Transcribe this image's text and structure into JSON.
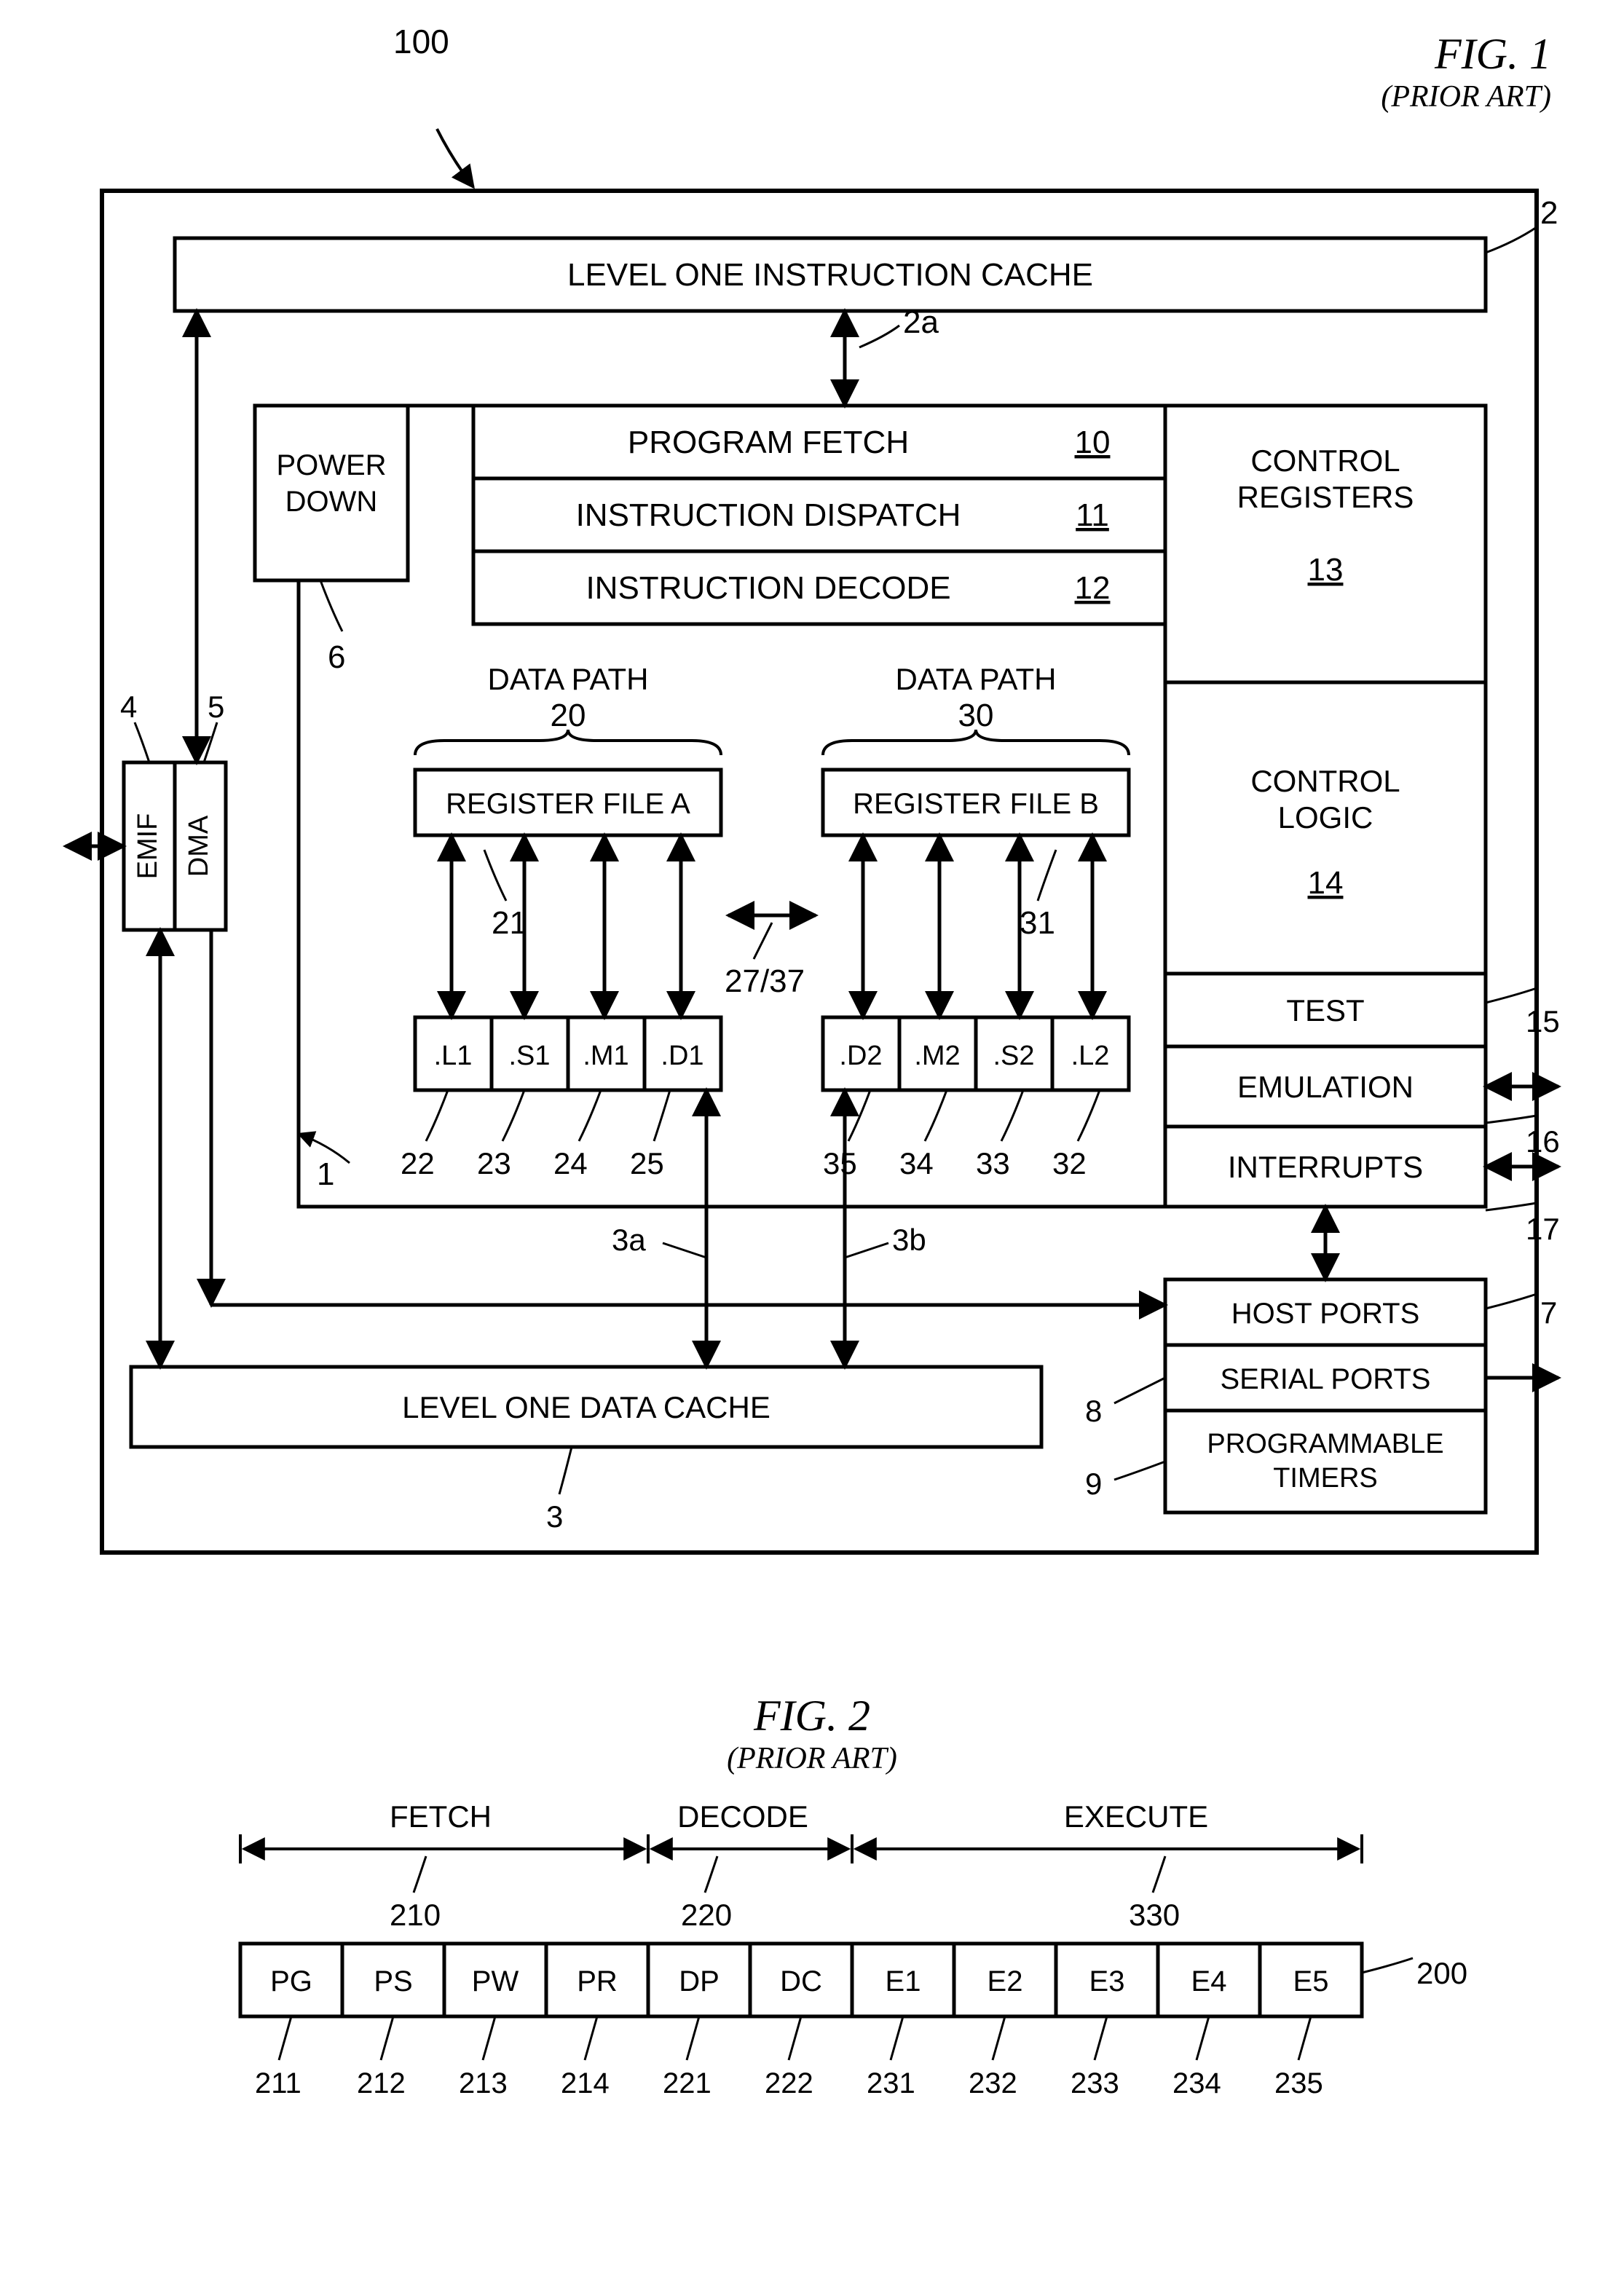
{
  "fig1": {
    "title": "FIG. 1",
    "subtitle": "(PRIOR ART)",
    "ref100": "100",
    "l1icache": "LEVEL ONE INSTRUCTION CACHE",
    "ref2": "2",
    "ref2a": "2a",
    "powerdown": "POWER\nDOWN",
    "ref6": "6",
    "progfetch": "PROGRAM FETCH",
    "ref10": "10",
    "instdispatch": "INSTRUCTION DISPATCH",
    "ref11": "11",
    "instdecode": "INSTRUCTION DECODE",
    "ref12": "12",
    "ctrlreg": "CONTROL\nREGISTERS",
    "ref13": "13",
    "datapath": "DATA PATH",
    "ref20": "20",
    "ref30": "30",
    "regfileA": "REGISTER FILE A",
    "regfileB": "REGISTER FILE B",
    "ctrllogic": "CONTROL\nLOGIC",
    "ref14": "14",
    "ref21": "21",
    "ref31": "31",
    "ref2737": "27/37",
    "L1": ".L1",
    "S1": ".S1",
    "M1": ".M1",
    "D1": ".D1",
    "D2": ".D2",
    "M2": ".M2",
    "S2": ".S2",
    "L2": ".L2",
    "ref22": "22",
    "ref23": "23",
    "ref24": "24",
    "ref25": "25",
    "ref35": "35",
    "ref34": "34",
    "ref33": "33",
    "ref32": "32",
    "ref1": "1",
    "test": "TEST",
    "ref15": "15",
    "emulation": "EMULATION",
    "ref16": "16",
    "interrupts": "INTERRUPTS",
    "ref17": "17",
    "ref3a": "3a",
    "ref3b": "3b",
    "hostports": "HOST PORTS",
    "ref7": "7",
    "serialports": "SERIAL PORTS",
    "ref8": "8",
    "progtimers": "PROGRAMMABLE\nTIMERS",
    "ref9": "9",
    "l1dcache": "LEVEL ONE DATA CACHE",
    "ref3": "3",
    "emif": "EMIF",
    "ref4": "4",
    "dma": "DMA",
    "ref5": "5"
  },
  "fig2": {
    "title": "FIG. 2",
    "subtitle": "(PRIOR ART)",
    "fetch": "FETCH",
    "ref210": "210",
    "decode": "DECODE",
    "ref220": "220",
    "execute": "EXECUTE",
    "ref330": "330",
    "ref200": "200",
    "PG": "PG",
    "PS": "PS",
    "PW": "PW",
    "PR": "PR",
    "DP": "DP",
    "DC": "DC",
    "E1": "E1",
    "E2": "E2",
    "E3": "E3",
    "E4": "E4",
    "E5": "E5",
    "ref211": "211",
    "ref212": "212",
    "ref213": "213",
    "ref214": "214",
    "ref221": "221",
    "ref222": "222",
    "ref231": "231",
    "ref232": "232",
    "ref233": "233",
    "ref234": "234",
    "ref235": "235"
  }
}
